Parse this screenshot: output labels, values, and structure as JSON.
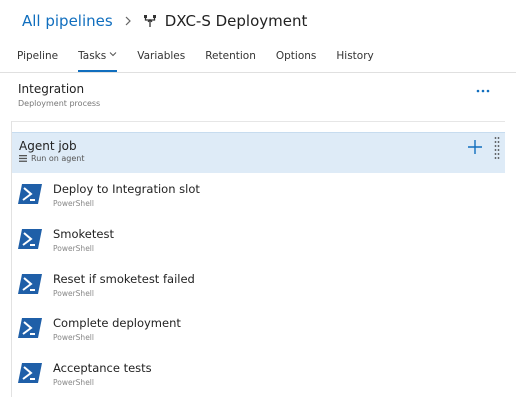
{
  "breadcrumb": {
    "root": "All pipelines",
    "separator_icon": "chevron-right-icon",
    "pipeline_icon": "release-pipeline-icon",
    "title": "DXC-S Deployment"
  },
  "tabs": [
    {
      "label": "Pipeline",
      "active": false
    },
    {
      "label": "Tasks",
      "active": true,
      "icon": "chevron-down-icon"
    },
    {
      "label": "Variables",
      "active": false
    },
    {
      "label": "Retention",
      "active": false
    },
    {
      "label": "Options",
      "active": false
    },
    {
      "label": "History",
      "active": false
    }
  ],
  "stage": {
    "title": "Integration",
    "subtitle": "Deployment process",
    "more_icon": "more-options-icon"
  },
  "agent_job": {
    "title": "Agent job",
    "subtitle": "Run on agent",
    "add_icon": "plus-icon",
    "drag_icon": "drag-handle-icon"
  },
  "tasks": [
    {
      "name": "Deploy to Integration slot",
      "type": "PowerShell",
      "icon": "powershell-icon"
    },
    {
      "name": "Smoketest",
      "type": "PowerShell",
      "icon": "powershell-icon"
    },
    {
      "name": "Reset if smoketest failed",
      "type": "PowerShell",
      "icon": "powershell-icon"
    },
    {
      "name": "Complete deployment",
      "type": "PowerShell",
      "icon": "powershell-icon"
    },
    {
      "name": "Acceptance tests",
      "type": "PowerShell",
      "icon": "powershell-icon"
    }
  ],
  "colors": {
    "accent": "#106ebe",
    "job_background": "#deebf7",
    "powershell_blue": "#1f5fa8"
  }
}
